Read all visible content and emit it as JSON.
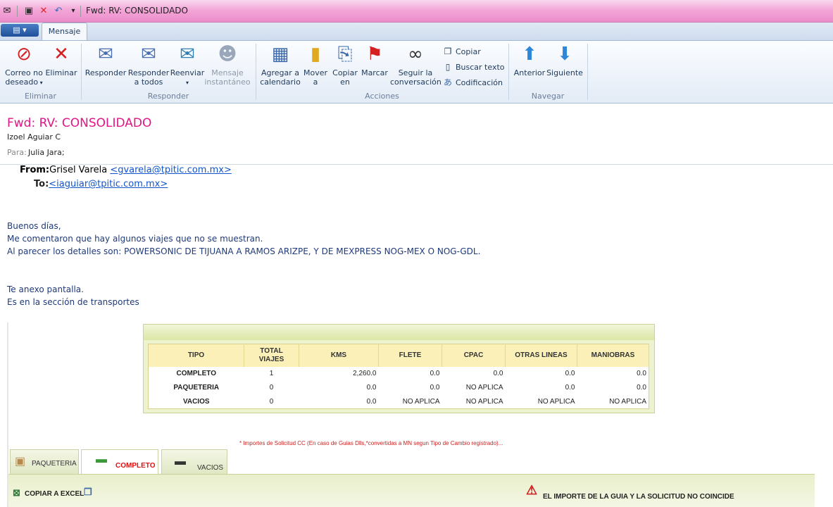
{
  "window": {
    "title": "Fwd: RV: CONSOLIDADO"
  },
  "tabs": {
    "active": "Mensaje"
  },
  "ribbon": {
    "groups": {
      "eliminar": "Eliminar",
      "responder": "Responder",
      "acciones": "Acciones",
      "navegar": "Navegar"
    },
    "correo_no_deseado": "Correo no deseado",
    "eliminar": "Eliminar",
    "responder": "Responder",
    "responder_todos": "Responder a todos",
    "reenviar": "Reenviar",
    "mensaje_instantaneo": "Mensaje instantáneo",
    "agregar_calendario": "Agregar a calendario",
    "mover_a": "Mover a",
    "copiar_en": "Copiar en",
    "marcar": "Marcar",
    "seguir_conversacion": "Seguir la conversación",
    "copiar": "Copiar",
    "buscar_texto": "Buscar texto",
    "codificacion": "Codificación",
    "anterior": "Anterior",
    "siguiente": "Siguiente"
  },
  "message": {
    "subject": "Fwd: RV: CONSOLIDADO",
    "sender": "Izoel Aguiar C",
    "to_label": "Para:",
    "to_value": "Julia Jara;",
    "from_label": "From:",
    "from_name": "Grisel Varela",
    "from_email": "<gvarela@tpitic.com.mx>",
    "to2_label": "To:",
    "to2_email": "<iaguiar@tpitic.com.mx>",
    "line1": "Buenos días,",
    "line2": "Me comentaron que hay algunos viajes que no se muestran.",
    "line3": "Al parecer los detalles son: POWERSONIC DE TIJUANA A RAMOS ARIZPE, Y DE MEXPRESS NOG-MEX O NOG-GDL.",
    "line4": "Te anexo pantalla.",
    "line5": "Es en la sección de transportes"
  },
  "screenshot": {
    "headers": [
      "TIPO",
      "TOTAL VIAJES",
      "KMS",
      "FLETE",
      "CPAC",
      "OTRAS LINEAS",
      "MANIOBRAS"
    ],
    "rows": [
      [
        "COMPLETO",
        "1",
        "2,260.0",
        "0.0",
        "0.0",
        "0.0",
        "0.0"
      ],
      [
        "PAQUETERIA",
        "0",
        "0.0",
        "0.0",
        "NO APLICA",
        "0.0",
        "0.0"
      ],
      [
        "VACIOS",
        "0",
        "0.0",
        "NO APLICA",
        "NO APLICA",
        "NO APLICA",
        "NO APLICA"
      ]
    ],
    "note": "* Importes de Solicitud CC (En caso de Guias Dlls,*convertidas a MN segun Tipo de Cambio registrado)...",
    "tab_paqueteria": "PAQUETERIA",
    "tab_completo": "COMPLETO",
    "tab_vacios": "VACIOS",
    "copiar_excel": "COPIAR A EXCEL",
    "warning": "EL IMPORTE DE LA GUIA Y LA SOLICITUD NO COINCIDE",
    "completo_color": "#dd1111"
  }
}
